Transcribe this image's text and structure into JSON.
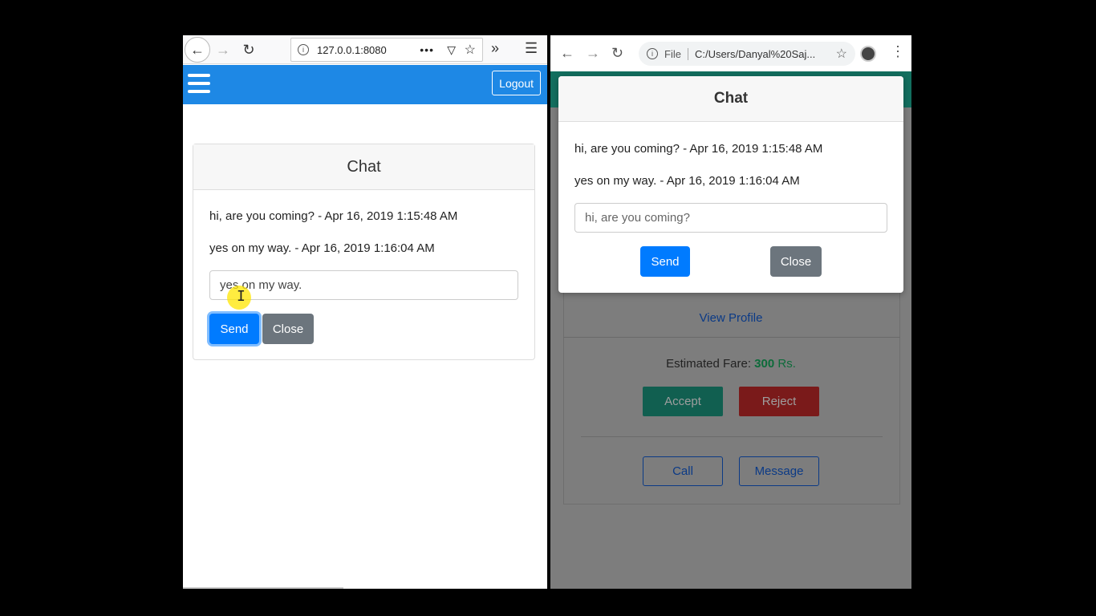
{
  "left_window": {
    "browser": {
      "url": "127.0.0.1:8080",
      "icons": [
        "back-icon",
        "forward-icon",
        "reload-icon",
        "info-icon",
        "more-icon",
        "pocket-icon",
        "star-icon",
        "overflow-icon",
        "menu-icon"
      ]
    },
    "navbar": {
      "logout_label": "Logout",
      "bg_color": "#1e88e5"
    },
    "chat": {
      "title": "Chat",
      "messages": [
        "hi, are you coming? - Apr 16, 2019 1:15:48 AM",
        "yes on my way. - Apr 16, 2019 1:16:04 AM"
      ],
      "input_value": "yes on my way.",
      "send_label": "Send",
      "close_label": "Close"
    }
  },
  "right_window": {
    "browser": {
      "scheme_label": "File",
      "url": "C:/Users/Danyal%20Saj...",
      "icons": [
        "back-icon",
        "forward-icon",
        "reload-icon",
        "info-icon",
        "star-icon",
        "avatar",
        "kebab-icon"
      ]
    },
    "chat_modal": {
      "title": "Chat",
      "messages": [
        "hi, are you coming? - Apr 16, 2019 1:15:48 AM",
        "yes on my way. - Apr 16, 2019 1:16:04 AM"
      ],
      "input_value": "hi, are you coming?",
      "send_label": "Send",
      "close_label": "Close"
    },
    "ride_card": {
      "view_profile_label": "View Profile",
      "fare_label": "Estimated Fare:",
      "fare_amount": "300",
      "fare_currency": "Rs.",
      "accept_label": "Accept",
      "reject_label": "Reject",
      "call_label": "Call",
      "message_label": "Message"
    }
  },
  "colors": {
    "primary": "#007bff",
    "secondary": "#6c757d",
    "teal": "#20c997",
    "danger": "#dc3545"
  }
}
